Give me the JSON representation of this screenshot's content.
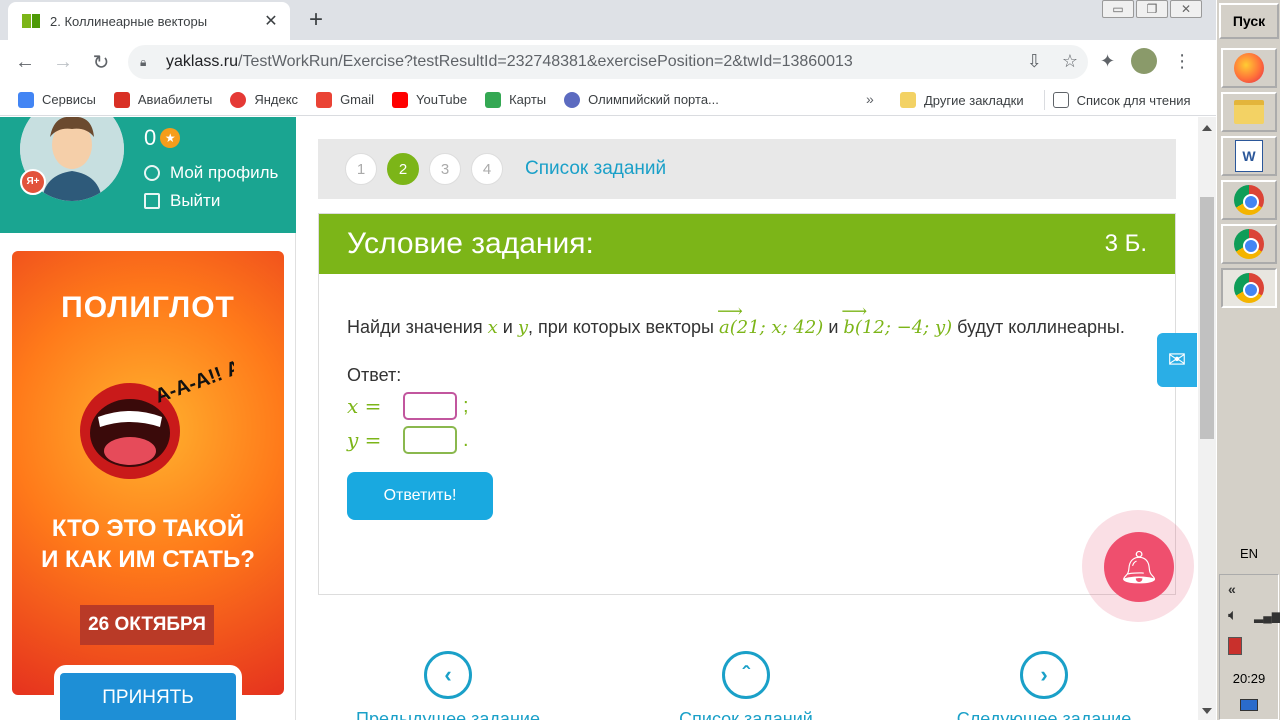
{
  "browser": {
    "tab_title": "2. Коллинеарные векторы",
    "tab_close": "✕",
    "new_tab": "+",
    "url_host": "yaklass.ru",
    "url_path": "/TestWorkRun/Exercise?testResultId=232748381&exercisePosition=2&twId=13860013",
    "bookmarks": [
      {
        "label": "Сервисы",
        "icon": "apps-grid-icon",
        "color": "#4285f4"
      },
      {
        "label": "Авиабилеты",
        "icon": "tickets-icon",
        "color": "#d93025"
      },
      {
        "label": "Яндекс",
        "icon": "yandex-icon",
        "color": "#e53935"
      },
      {
        "label": "Gmail",
        "icon": "gmail-icon",
        "color": "#ea4335"
      },
      {
        "label": "YouTube",
        "icon": "youtube-icon",
        "color": "#ff0000"
      },
      {
        "label": "Карты",
        "icon": "maps-icon",
        "color": "#34a853"
      },
      {
        "label": "Олимпийский порта...",
        "icon": "olympic-portal-icon",
        "color": "#5c6bc0"
      }
    ],
    "bookmarks_more": "»",
    "bookmark_other": "Другие закладки",
    "reading_list": "Список для чтения"
  },
  "profile": {
    "score": "0",
    "my_profile": "Мой профиль",
    "logout": "Выйти"
  },
  "ad": {
    "title": "ПОЛИГЛОТ",
    "exclaim": "А-А-А!! А-А-АА!!",
    "subtitle_line1": "КТО ЭТО ТАКОЙ",
    "subtitle_line2": "И КАК ИМ СТАТЬ?",
    "date": "26 ОКТЯБРЯ",
    "cta": "ПРИНЯТЬ УЧАСТИЕ"
  },
  "task_nav": {
    "numbers": [
      "1",
      "2",
      "3",
      "4"
    ],
    "active_index": 1,
    "list_link": "Список заданий"
  },
  "task": {
    "header": "Условие задания:",
    "points": "3 Б.",
    "q_prefix": "Найди значения",
    "var_x": "x",
    "q_and": "и",
    "var_y": "y",
    "q_mid": ", при которых векторы",
    "vec_a": "a",
    "vec_a_coords": "(21; x; 42)",
    "q_and2": "и",
    "vec_b": "b",
    "vec_b_coords": "(12; −4; y)",
    "q_suffix": "будут коллинеарны.",
    "answer_label": "Ответ:",
    "x_label": "x =",
    "y_label": "y =",
    "x_end": ";",
    "y_end": ".",
    "submit": "Ответить!"
  },
  "bottom_nav": {
    "prev": "Предыдущее задание",
    "list": "Список заданий",
    "next": "Следующее задание"
  },
  "taskbar": {
    "start": "Пуск",
    "lang": "EN",
    "clock": "20:29",
    "tray_chevron": "«"
  },
  "colors": {
    "brand_green": "#7cb518",
    "teal": "#1aa591",
    "link_blue": "#1aa0c8",
    "button_blue": "#19a9e0"
  }
}
